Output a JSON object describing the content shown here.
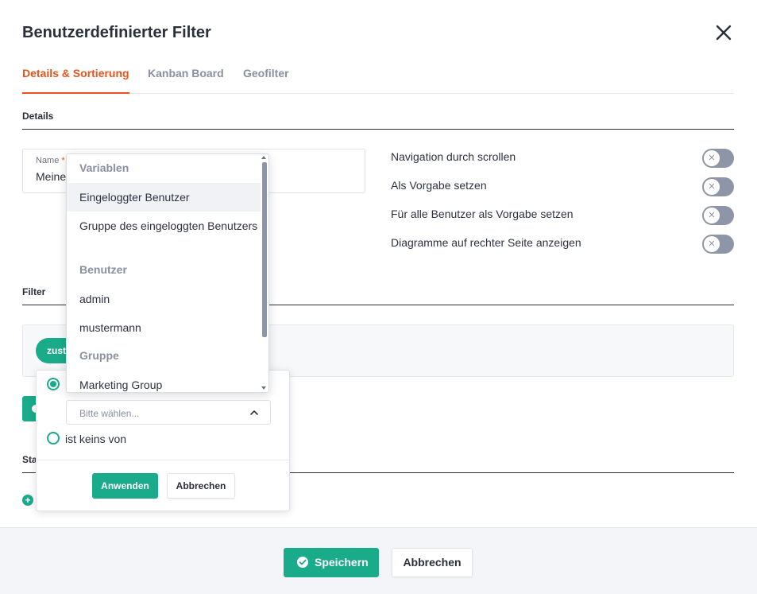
{
  "dialog": {
    "title": "Benutzerdefinierter Filter",
    "close_icon": "close-icon"
  },
  "tabs": [
    {
      "label": "Details & Sortierung",
      "active": true
    },
    {
      "label": "Kanban Board",
      "active": false
    },
    {
      "label": "Geofilter",
      "active": false
    }
  ],
  "details": {
    "section_title": "Details",
    "name_label": "Name",
    "name_required_mark": "*",
    "name_value": "Meine"
  },
  "toggles": [
    {
      "label": "Navigation durch scrollen",
      "on": false
    },
    {
      "label": "Als Vorgabe setzen",
      "on": false
    },
    {
      "label": "Für alle Benutzer als Vorgabe setzen",
      "on": false
    },
    {
      "label": "Diagramme auf rechter Seite anzeigen",
      "on": false
    }
  ],
  "filter": {
    "section_title": "Filter",
    "chip_label": "zustä"
  },
  "partial_section_title": "Sta",
  "popover": {
    "select_placeholder": "Bitte wählen...",
    "option_none_label": "ist keins von",
    "apply_label": "Anwenden",
    "cancel_label": "Abbrechen"
  },
  "dropdown": {
    "groups": [
      {
        "label": "Variablen",
        "items": [
          "Eingeloggter Benutzer",
          "Gruppe des eingeloggten Benutzers"
        ]
      },
      {
        "label": "Benutzer",
        "items": [
          "admin",
          "mustermann"
        ]
      },
      {
        "label": "Gruppe",
        "items": [
          "Marketing Group"
        ]
      }
    ]
  },
  "footer": {
    "save_label": "Speichern",
    "cancel_label": "Abbrechen"
  },
  "colors": {
    "accent_orange": "#e8541c",
    "accent_green": "#1aab8a",
    "toggle_off": "#8e95a6"
  }
}
